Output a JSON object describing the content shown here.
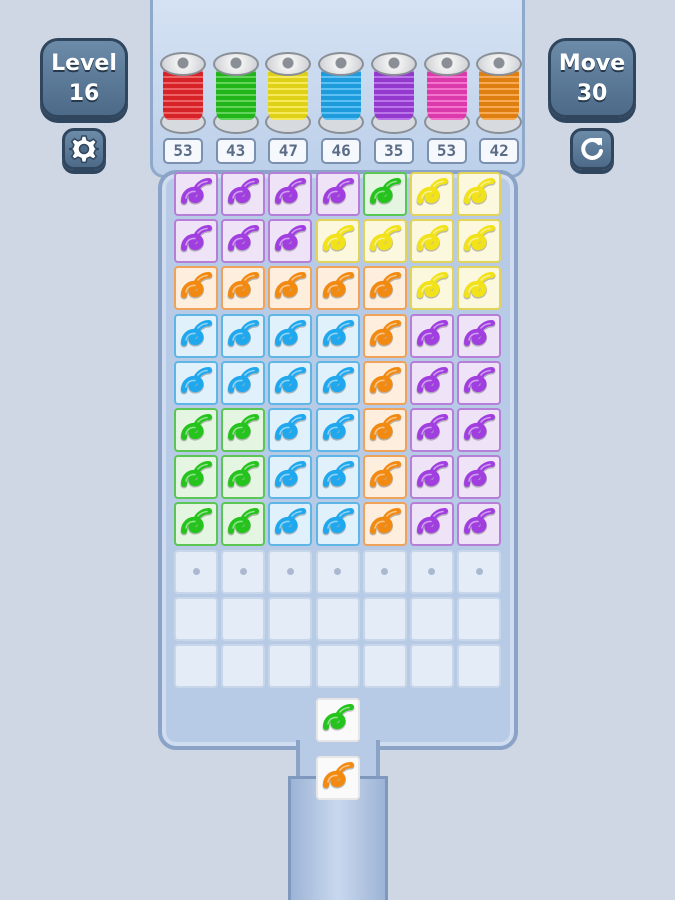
{
  "hud": {
    "level_label": "Level",
    "level_value": "16",
    "move_label": "Move",
    "move_value": "30"
  },
  "colors": {
    "red": "#e8262b",
    "green": "#25c41c",
    "yellow": "#f2e21a",
    "blue": "#1fa8ee",
    "purple": "#a13ee0",
    "pink": "#ee3fb8",
    "orange": "#f28a12"
  },
  "tile_styles": {
    "purple": {
      "bg": "#efe3f8",
      "border": "#b57fd8"
    },
    "green": {
      "bg": "#e4f6e2",
      "border": "#5bc653"
    },
    "yellow": {
      "bg": "#fbf8de",
      "border": "#e2d45a"
    },
    "orange": {
      "bg": "#fdeedd",
      "border": "#eea25a"
    },
    "blue": {
      "bg": "#e0f1fb",
      "border": "#5fb6e6"
    }
  },
  "spools": [
    {
      "color": "red",
      "count": "53"
    },
    {
      "color": "green",
      "count": "43"
    },
    {
      "color": "yellow",
      "count": "47"
    },
    {
      "color": "blue",
      "count": "46"
    },
    {
      "color": "purple",
      "count": "35"
    },
    {
      "color": "pink",
      "count": "53"
    },
    {
      "color": "orange",
      "count": "42"
    }
  ],
  "grid": [
    [
      "purple",
      "purple",
      "purple",
      "purple",
      "green",
      "yellow",
      "yellow"
    ],
    [
      "purple",
      "purple",
      "purple",
      "yellow",
      "yellow",
      "yellow",
      "yellow"
    ],
    [
      "orange",
      "orange",
      "orange",
      "orange",
      "orange",
      "yellow",
      "yellow"
    ],
    [
      "blue",
      "blue",
      "blue",
      "blue",
      "orange",
      "purple",
      "purple"
    ],
    [
      "blue",
      "blue",
      "blue",
      "blue",
      "orange",
      "purple",
      "purple"
    ],
    [
      "green",
      "green",
      "blue",
      "blue",
      "orange",
      "purple",
      "purple"
    ],
    [
      "green",
      "green",
      "blue",
      "blue",
      "orange",
      "purple",
      "purple"
    ],
    [
      "green",
      "green",
      "blue",
      "blue",
      "orange",
      "purple",
      "purple"
    ]
  ],
  "empty_rows": 3,
  "queue": [
    "green",
    "orange"
  ],
  "icons": {
    "settings": "gear-icon",
    "restart": "restart-icon",
    "thread": "yarn-icon"
  }
}
